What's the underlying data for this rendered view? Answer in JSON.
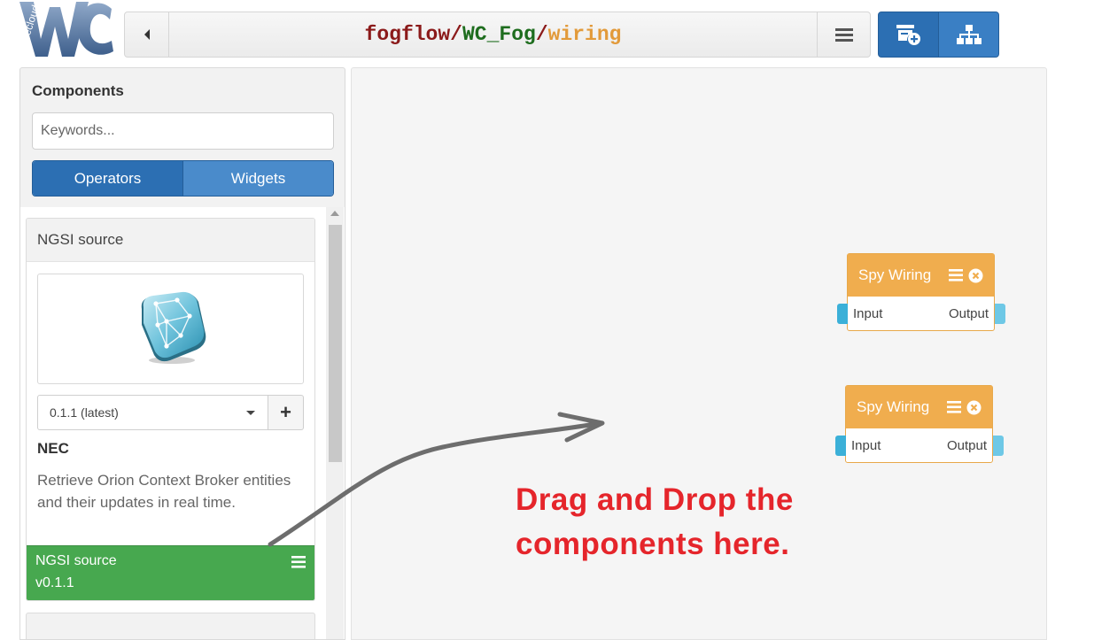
{
  "header": {
    "path": {
      "owner": "fogflow",
      "separator1": "/",
      "workspace": "WC_Fog",
      "separator2": "/",
      "view": "wiring"
    },
    "logo_text": "Wirecloud"
  },
  "sidebar": {
    "title": "Components",
    "search": {
      "placeholder": "Keywords...",
      "value": ""
    },
    "tabs": [
      {
        "label": "Operators",
        "active": true
      },
      {
        "label": "Widgets",
        "active": false
      }
    ],
    "component": {
      "header": "NGSI source",
      "version_selected": "0.1.1 (latest)",
      "add_label": "+",
      "vendor": "NEC",
      "description": "Retrieve Orion Context Broker entities and their updates in real time.",
      "footer_name": "NGSI source",
      "footer_version": "v0.1.1"
    }
  },
  "canvas": {
    "operators": [
      {
        "title": "Spy Wiring",
        "input": "Input",
        "output": "Output"
      },
      {
        "title": "Spy Wiring",
        "input": "Input",
        "output": "Output"
      }
    ],
    "annotation": {
      "line1": "Drag and Drop the",
      "line2": "components here."
    }
  },
  "colors": {
    "primary": "#2c6fb3",
    "operator": "#f0ad4e",
    "component_footer": "#47a84f",
    "endpoint": "#3bb0d8",
    "annotation": "#e5252b"
  },
  "icons": {
    "back": "chevron-left-icon",
    "menu": "hamburger-menu-icon",
    "add_component": "add-component-icon",
    "behaviours": "sitemap-icon",
    "close": "close-circle-icon"
  }
}
